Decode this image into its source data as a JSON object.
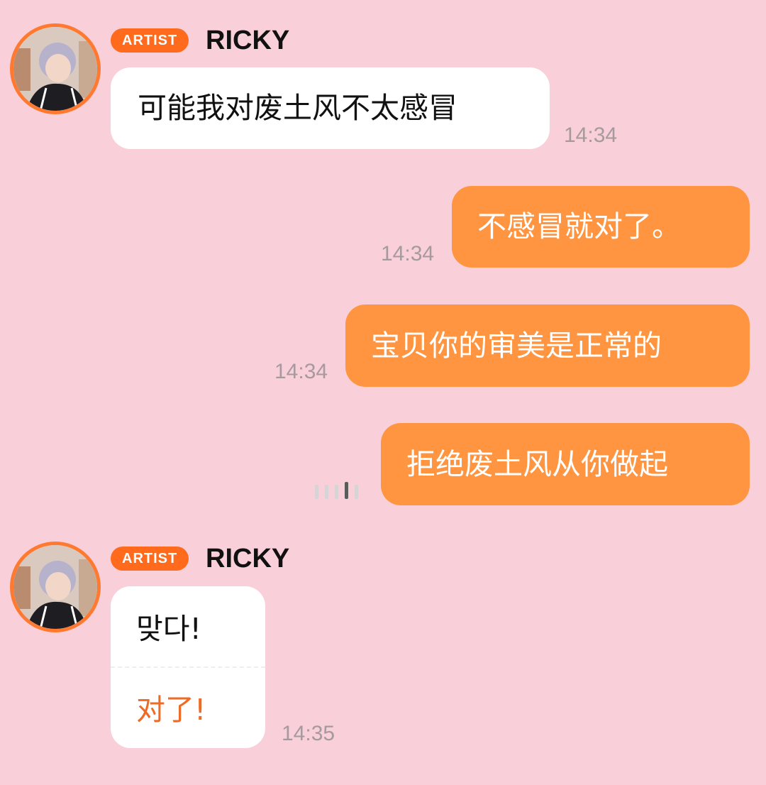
{
  "colors": {
    "background": "#f9cfd9",
    "accent": "#ff6a1c",
    "outgoing_bubble": "#ff9540",
    "incoming_bubble": "#ffffff",
    "translation_text": "#ef6a24"
  },
  "messages": [
    {
      "sender_badge": "ARTIST",
      "sender_name": "RICKY",
      "text": "可能我对废土风不太感冒",
      "time": "14:34"
    },
    {
      "text": "不感冒就对了。",
      "time": "14:34"
    },
    {
      "text": "宝贝你的审美是正常的",
      "time": "14:34"
    },
    {
      "text": "拒绝废土风从你做起",
      "status_icon": "sending-icon"
    },
    {
      "sender_badge": "ARTIST",
      "sender_name": "RICKY",
      "text": "맞다!",
      "translation": "对了!",
      "time": "14:35"
    }
  ]
}
